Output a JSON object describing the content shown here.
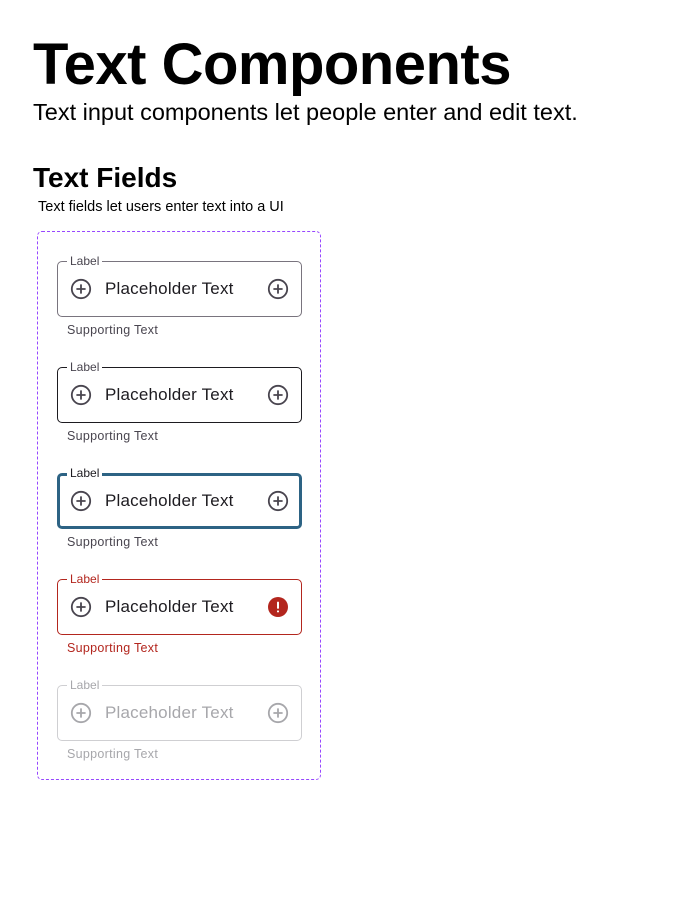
{
  "header": {
    "title": "Text Components",
    "subtitle": "Text input components let people enter and edit text."
  },
  "section": {
    "title": "Text Fields",
    "description": "Text fields let users enter text into a UI"
  },
  "colors": {
    "frame_border": "#9747ff",
    "outline": "#79747e",
    "focus": "#2d6384",
    "error": "#b3261e",
    "disabled": "#a7a7ab"
  },
  "fields": [
    {
      "state": "enabled",
      "label": "Label",
      "placeholder": "Placeholder Text",
      "supporting_text": "Supporting Text",
      "leading_icon": "add-circle-icon",
      "trailing_icon": "add-circle-icon"
    },
    {
      "state": "hovered",
      "label": "Label",
      "placeholder": "Placeholder Text",
      "supporting_text": "Supporting Text",
      "leading_icon": "add-circle-icon",
      "trailing_icon": "add-circle-icon"
    },
    {
      "state": "focused",
      "label": "Label",
      "placeholder": "Placeholder Text",
      "supporting_text": "Supporting Text",
      "leading_icon": "add-circle-icon",
      "trailing_icon": "add-circle-icon"
    },
    {
      "state": "error",
      "label": "Label",
      "placeholder": "Placeholder Text",
      "supporting_text": "Supporting Text",
      "leading_icon": "add-circle-icon",
      "trailing_icon": "error-icon"
    },
    {
      "state": "disabled",
      "label": "Label",
      "placeholder": "Placeholder Text",
      "supporting_text": "Supporting Text",
      "leading_icon": "add-circle-icon",
      "trailing_icon": "add-circle-icon"
    }
  ]
}
